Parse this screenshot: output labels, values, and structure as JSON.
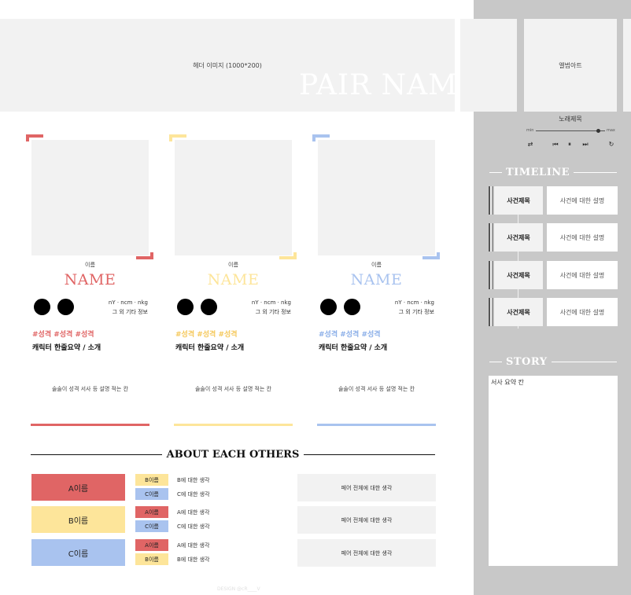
{
  "header": {
    "image_label": "헤더 이미지 (1000*200)",
    "pair_name": "PAIR NAME"
  },
  "music": {
    "album_label": "앨범아트",
    "song_title": "노래제목",
    "min_label": "min",
    "max_label": "max",
    "progress": 0.9,
    "controls": {
      "shuffle": "⇄",
      "prev": "⏮",
      "pause": "⏸",
      "next": "⏭",
      "repeat": "↻"
    }
  },
  "timeline": {
    "title": "TIMELINE",
    "events": [
      {
        "title": "사건제목",
        "desc": "사건에 대한 설명"
      },
      {
        "title": "사건제목",
        "desc": "사건에 대한 설명"
      },
      {
        "title": "사건제목",
        "desc": "사건에 대한 설명"
      },
      {
        "title": "사건제목",
        "desc": "사건에 대한 설명"
      }
    ]
  },
  "story": {
    "title": "STORY",
    "summary": "서사 요약 칸"
  },
  "characters": [
    {
      "label": "이름",
      "name": "NAME",
      "color": "#e06565",
      "tags": "nY · ncm · nkg",
      "extra": "그 외 기타 정보",
      "hashtags": "#성격 #성격 #성격",
      "oneline": "캐릭터 한줄요약 / 소개",
      "desc": "술술이 성격 서사 등 설명 적는 칸"
    },
    {
      "label": "이름",
      "name": "NAME",
      "color": "#fde59a",
      "tags": "nY · ncm · nkg",
      "extra": "그 외 기타 정보",
      "hashtags": "#성격 #성격 #성격",
      "oneline": "캐릭터 한줄요약 / 소개",
      "desc": "술술이 성격 서사 등 설명 적는 칸"
    },
    {
      "label": "이름",
      "name": "NAME",
      "color": "#a9c3ef",
      "tags": "nY · ncm · nkg",
      "extra": "그 외 기타 정보",
      "hashtags": "#성격 #성격 #성격",
      "oneline": "캐릭터 한줄요약 / 소개",
      "desc": "술술이 성격 서사 등 설명 적는 칸"
    }
  ],
  "about": {
    "title": "ABOUT EACH OTHERS",
    "rows": [
      {
        "name": "A이름",
        "color": "#e06565",
        "others": [
          {
            "chip": "B이름",
            "color": "#fde59a",
            "text": "B에 대한 생각"
          },
          {
            "chip": "C이름",
            "color": "#a9c3ef",
            "text": "C에 대한 생각"
          }
        ],
        "pair_text": "페어 전체에 대한 생각"
      },
      {
        "name": "B이름",
        "color": "#fde59a",
        "others": [
          {
            "chip": "A이름",
            "color": "#e06565",
            "text": "A에 대한 생각"
          },
          {
            "chip": "C이름",
            "color": "#a9c3ef",
            "text": "C에 대한 생각"
          }
        ],
        "pair_text": "페어 전체에 대한 생각"
      },
      {
        "name": "C이름",
        "color": "#a9c3ef",
        "others": [
          {
            "chip": "A이름",
            "color": "#e06565",
            "text": "A에 대한 생각"
          },
          {
            "chip": "B이름",
            "color": "#fde59a",
            "text": "B에 대한 생각"
          }
        ],
        "pair_text": "페어 전체에 대한 생각"
      }
    ]
  },
  "credit": "DESIGN @cR____V"
}
